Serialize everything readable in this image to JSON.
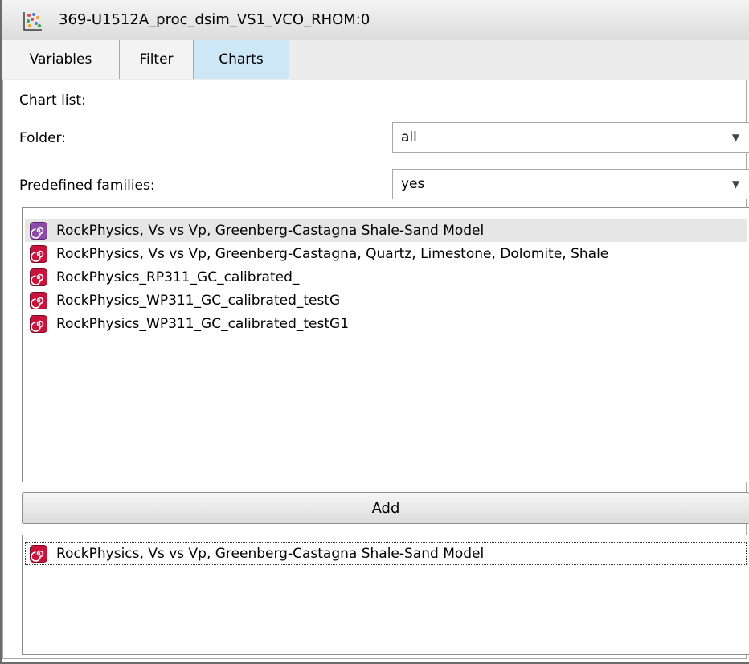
{
  "window": {
    "title": "369-U1512A_proc_dsim_VS1_VCO_RHOM:0"
  },
  "tabs": [
    {
      "label": "Variables",
      "active": false
    },
    {
      "label": "Filter",
      "active": false
    },
    {
      "label": "Charts",
      "active": true
    }
  ],
  "charts_panel": {
    "chart_list_label": "Chart list:",
    "folder": {
      "label": "Folder:",
      "value": "all"
    },
    "predefined_families": {
      "label": "Predefined families:",
      "value": "yes"
    },
    "available_charts": [
      "RockPhysics, Vs vs Vp, Greenberg-Castagna Shale-Sand Model",
      "RockPhysics, Vs vs Vp, Greenberg-Castagna, Quartz, Limestone, Dolomite, Shale",
      "RockPhysics_RP311_GC_calibrated_",
      "RockPhysics_WP311_GC_calibrated_testG",
      "RockPhysics_WP311_GC_calibrated_testG1"
    ],
    "hovered_index": 0,
    "add_label": "Add",
    "selected_charts": [
      "RockPhysics, Vs vs Vp, Greenberg-Castagna Shale-Sand Model"
    ]
  },
  "icons": {
    "app": "scatter-plot-icon",
    "item": "spiral-chart-icon"
  },
  "colors": {
    "active_tab": "#cde7f7",
    "item_icon_purple": "#8e4aa8",
    "item_icon_red": "#c8143c"
  }
}
